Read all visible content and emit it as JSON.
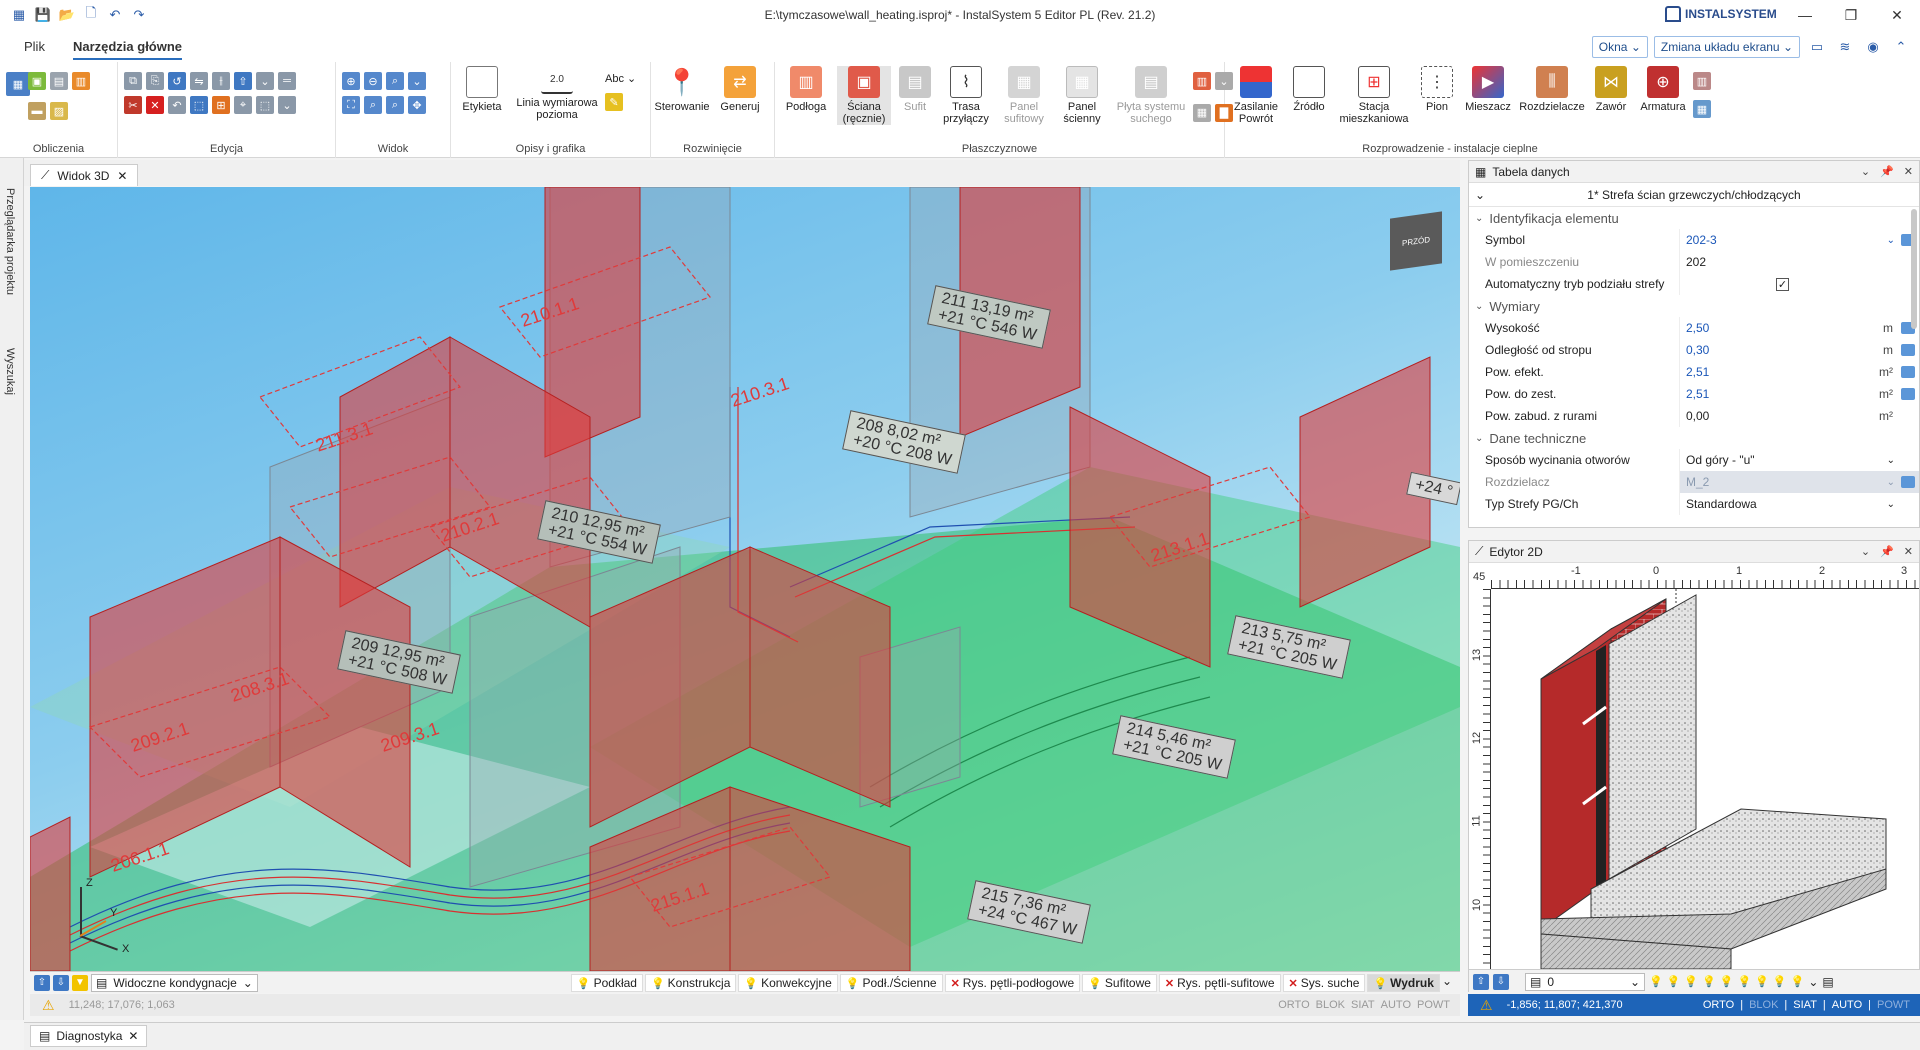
{
  "window": {
    "title": "E:\\tymczasowe\\wall_heating.isproj* - InstalSystem 5 Editor PL (Rev. 21.2)",
    "brand": "INSTALSYSTEM"
  },
  "ribbon_tabs": [
    "Plik",
    "Narzędzia główne"
  ],
  "ribbon_right": {
    "okna": "Okna",
    "zmiana": "Zmiana układu ekranu"
  },
  "groups": {
    "obliczenia": "Obliczenia",
    "edycja": "Edycja",
    "widok": "Widok",
    "opisy": "Opisy i grafika",
    "rozwiniecie": "Rozwinięcie",
    "plaszczyznowe": "Płaszczyznowe",
    "rozprowadzenie": "Rozprowadzenie - instalacje cieplne"
  },
  "buttons": {
    "etykieta": "Etykieta",
    "linia_wym": "Linia wymiarowa pozioma",
    "abc": "Abc",
    "sterowanie": "Sterowanie",
    "generuj": "Generuj",
    "podloga": "Podłoga",
    "sciana": "Ściana (ręcznie)",
    "sufit": "Sufit",
    "trasa": "Trasa przyłączy",
    "panel_sufitowy": "Panel sufitowy",
    "panel_scienny": "Panel ścienny",
    "plyta": "Płyta systemu suchego",
    "zasilanie": "Zasilanie Powrót",
    "zrodlo": "Źródło",
    "stacja": "Stacja mieszkaniowa",
    "pion": "Pion",
    "mieszacz": "Mieszacz",
    "rozdzielacze": "Rozdzielacze",
    "zawor": "Zawór",
    "armatura": "Armatura",
    "dim_value": "2.0"
  },
  "left_tabs": [
    "Przeglądarka projektu",
    "Wyszukaj"
  ],
  "doc_tab": "Widok 3D",
  "view3d": {
    "nav_cube": "PRZÓD",
    "axes": {
      "x": "X",
      "y": "Y",
      "z": "Z"
    },
    "room_labels": [
      {
        "line1": "211  13,19 m²",
        "line2": "+21 °C  546 W"
      },
      {
        "line1": "208  8,02 m²",
        "line2": "+20 °C  208 W"
      },
      {
        "line1": "210  12,95 m²",
        "line2": "+21 °C  554 W"
      },
      {
        "line1": "209  12,95 m²",
        "line2": "+21 °C  508 W"
      },
      {
        "line1": "213  5,75 m²",
        "line2": "+21 °C  205 W"
      },
      {
        "line1": "214  5,46 m²",
        "line2": "+21 °C  205 W"
      },
      {
        "line1": "215  7,36 m²",
        "line2": "+24 °C  467 W"
      },
      {
        "line1": "+24 °",
        "line2": ""
      }
    ],
    "zone_labels": [
      "210.1.1",
      "210.3.1",
      "211.3.1",
      "210.2.1",
      "213.1.1",
      "208.3.1",
      "209.2.1",
      "209.3.1",
      "206.1.1",
      "215.1.1"
    ]
  },
  "viewbar": {
    "visibility": "Widoczne kondygnacje",
    "toggles": [
      {
        "label": "Podkład",
        "icon": "bulb",
        "on": false
      },
      {
        "label": "Konstrukcja",
        "icon": "bulb",
        "on": false
      },
      {
        "label": "Konwekcyjne",
        "icon": "bulb",
        "on": false
      },
      {
        "label": "Podł./Ścienne",
        "icon": "bulb",
        "on": false
      },
      {
        "label": "Rys. pętli-podłogowe",
        "icon": "x",
        "on": false
      },
      {
        "label": "Sufitowe",
        "icon": "bulb",
        "on": false
      },
      {
        "label": "Rys. pętli-sufitowe",
        "icon": "x",
        "on": false
      },
      {
        "label": "Sys. suche",
        "icon": "x",
        "on": false
      },
      {
        "label": "Wydruk",
        "icon": "bulb",
        "on": true
      }
    ]
  },
  "status_left": {
    "coords": "11,248; 17,076; 1,063",
    "modes": [
      "ORTO",
      "BLOK",
      "SIAT",
      "AUTO",
      "POWT"
    ]
  },
  "status_right": {
    "coords": "-1,856; 11,807; 421,370",
    "modes": [
      "ORTO",
      "BLOK",
      "SIAT",
      "AUTO",
      "POWT"
    ]
  },
  "data_panel": {
    "title": "Tabela danych",
    "zone_title": "1* Strefa ścian grzewczych/chłodzących",
    "sections": [
      {
        "title": "Identyfikacja elementu",
        "rows": [
          {
            "name": "Symbol",
            "value": "202-3",
            "style": "blue",
            "dropdown": true,
            "pick": true
          },
          {
            "name": "W pomieszczeniu",
            "value": "202",
            "style": "",
            "disabled_name": true
          },
          {
            "name": "Automatyczny tryb podziału strefy",
            "value": "",
            "checkbox": true
          }
        ]
      },
      {
        "title": "Wymiary",
        "rows": [
          {
            "name": "Wysokość",
            "value": "2,50",
            "unit": "m",
            "style": "blue",
            "pick": true
          },
          {
            "name": "Odległość od stropu",
            "value": "0,30",
            "unit": "m",
            "style": "blue",
            "pick": true
          },
          {
            "name": "Pow. efekt.",
            "value": "2,51",
            "unit": "m²",
            "style": "blue",
            "pick": true
          },
          {
            "name": "Pow. do zest.",
            "value": "2,51",
            "unit": "m²",
            "style": "blue",
            "pick": true
          },
          {
            "name": "Pow. zabud. z rurami",
            "value": "0,00",
            "unit": "m²",
            "style": ""
          }
        ]
      },
      {
        "title": "Dane techniczne",
        "rows": [
          {
            "name": "Sposób wycinania otworów",
            "value": "Od góry - \"u\"",
            "style": "",
            "dropdown": true
          },
          {
            "name": "Rozdzielacz",
            "value": "M_2",
            "style": "dis",
            "dropdown": true,
            "pick": true,
            "disabled_name": true
          },
          {
            "name": "Typ Strefy PG/Ch",
            "value": "Standardowa",
            "style": "",
            "dropdown": true
          }
        ]
      }
    ]
  },
  "editor2d": {
    "title": "Edytor 2D",
    "ruler_top": [
      "-1",
      "0",
      "1",
      "2",
      "3"
    ],
    "ruler_left": [
      "13",
      "12",
      "11",
      "10"
    ],
    "ruler_corner": "45",
    "layer_value": "0"
  },
  "diagnostics": "Diagnostyka",
  "colors": {
    "accent": "#1e64b8",
    "wall_red": "#e03a3a",
    "floor_green": "#2fbf6a"
  }
}
